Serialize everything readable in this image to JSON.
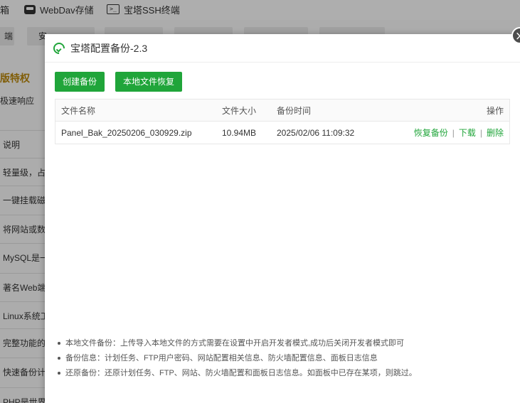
{
  "topbar": {
    "partial_left": "箱",
    "webdav_label": "WebDav存储",
    "ssh_label": "宝塔SSH终端",
    "ssh_icon_text": ">_"
  },
  "tabs": [
    "端",
    "安"
  ],
  "sidebar": {
    "heading": "版特权",
    "subheading": "极速响应",
    "items": [
      "说明",
      "轻量级，占有",
      "一键挂载磁盘",
      "将网站或数据",
      "MySQL是一",
      "著名Web端N",
      "Linux系统工",
      "完整功能的S",
      "快速备份计划",
      "PHP是世界上最好的编程语言"
    ]
  },
  "dialog": {
    "title": "宝塔配置备份-2.3",
    "close_symbol": "×",
    "buttons": {
      "create": "创建备份",
      "restore_local": "本地文件恢复"
    },
    "table": {
      "headers": [
        "文件名称",
        "文件大小",
        "备份时间",
        "操作"
      ],
      "rows": [
        {
          "name": "Panel_Bak_20250206_030929.zip",
          "size": "10.94MB",
          "time": "2025/02/06 11:09:32",
          "ops": [
            "恢复备份",
            "下载",
            "删除"
          ]
        }
      ]
    },
    "notes": [
      "本地文件备份：上传导入本地文件的方式需要在设置中开启开发者模式,成功后关闭开发者模式即可",
      "备份信息：计划任务、FTP用户密码、网站配置相关信息、防火墙配置信息、面板日志信息",
      "还原备份：还原计划任务、FTP、网站、防火墙配置和面板日志信息。如面板中已存在某项，则跳过。"
    ]
  },
  "colors": {
    "accent": "#20a53a",
    "overlay": "rgba(0,0,0,0.30)"
  }
}
